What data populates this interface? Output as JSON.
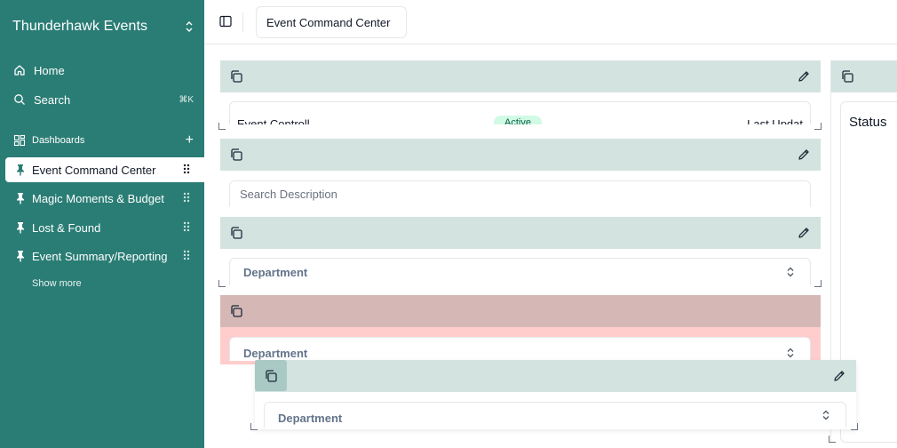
{
  "app": {
    "workspace_name": "Thunderhawk Events"
  },
  "sidebar": {
    "nav": [
      {
        "label": "Home",
        "icon": "home-icon"
      },
      {
        "label": "Search",
        "icon": "search-icon",
        "shortcut": "⌘K"
      }
    ],
    "dashboards_label": "Dashboards",
    "pinned": [
      {
        "label": "Event Command Center",
        "active": true
      },
      {
        "label": "Magic Moments & Budget",
        "active": false
      },
      {
        "label": "Lost & Found",
        "active": false
      },
      {
        "label": "Event Summary/Reporting",
        "active": false
      }
    ],
    "show_more": "Show more"
  },
  "header": {
    "title_value": "Event Command Center"
  },
  "widgets": {
    "w1": {
      "left_text": "Event Controll",
      "badge_text": "Active",
      "right_text": "Last Updat"
    },
    "w2": {
      "placeholder": "Search Description"
    },
    "w3": {
      "select_value": "Department"
    },
    "w4": {
      "select_value": "Department"
    },
    "w5": {
      "select_value": "Department"
    },
    "status": {
      "title": "Status"
    }
  },
  "colors": {
    "sidebar_bg": "#2a7d75",
    "widget_bar": "#d3e3e0",
    "danger_bar": "#d5b8b6",
    "danger_bg": "#ffcdcb",
    "badge_bg": "#d1fae5"
  }
}
